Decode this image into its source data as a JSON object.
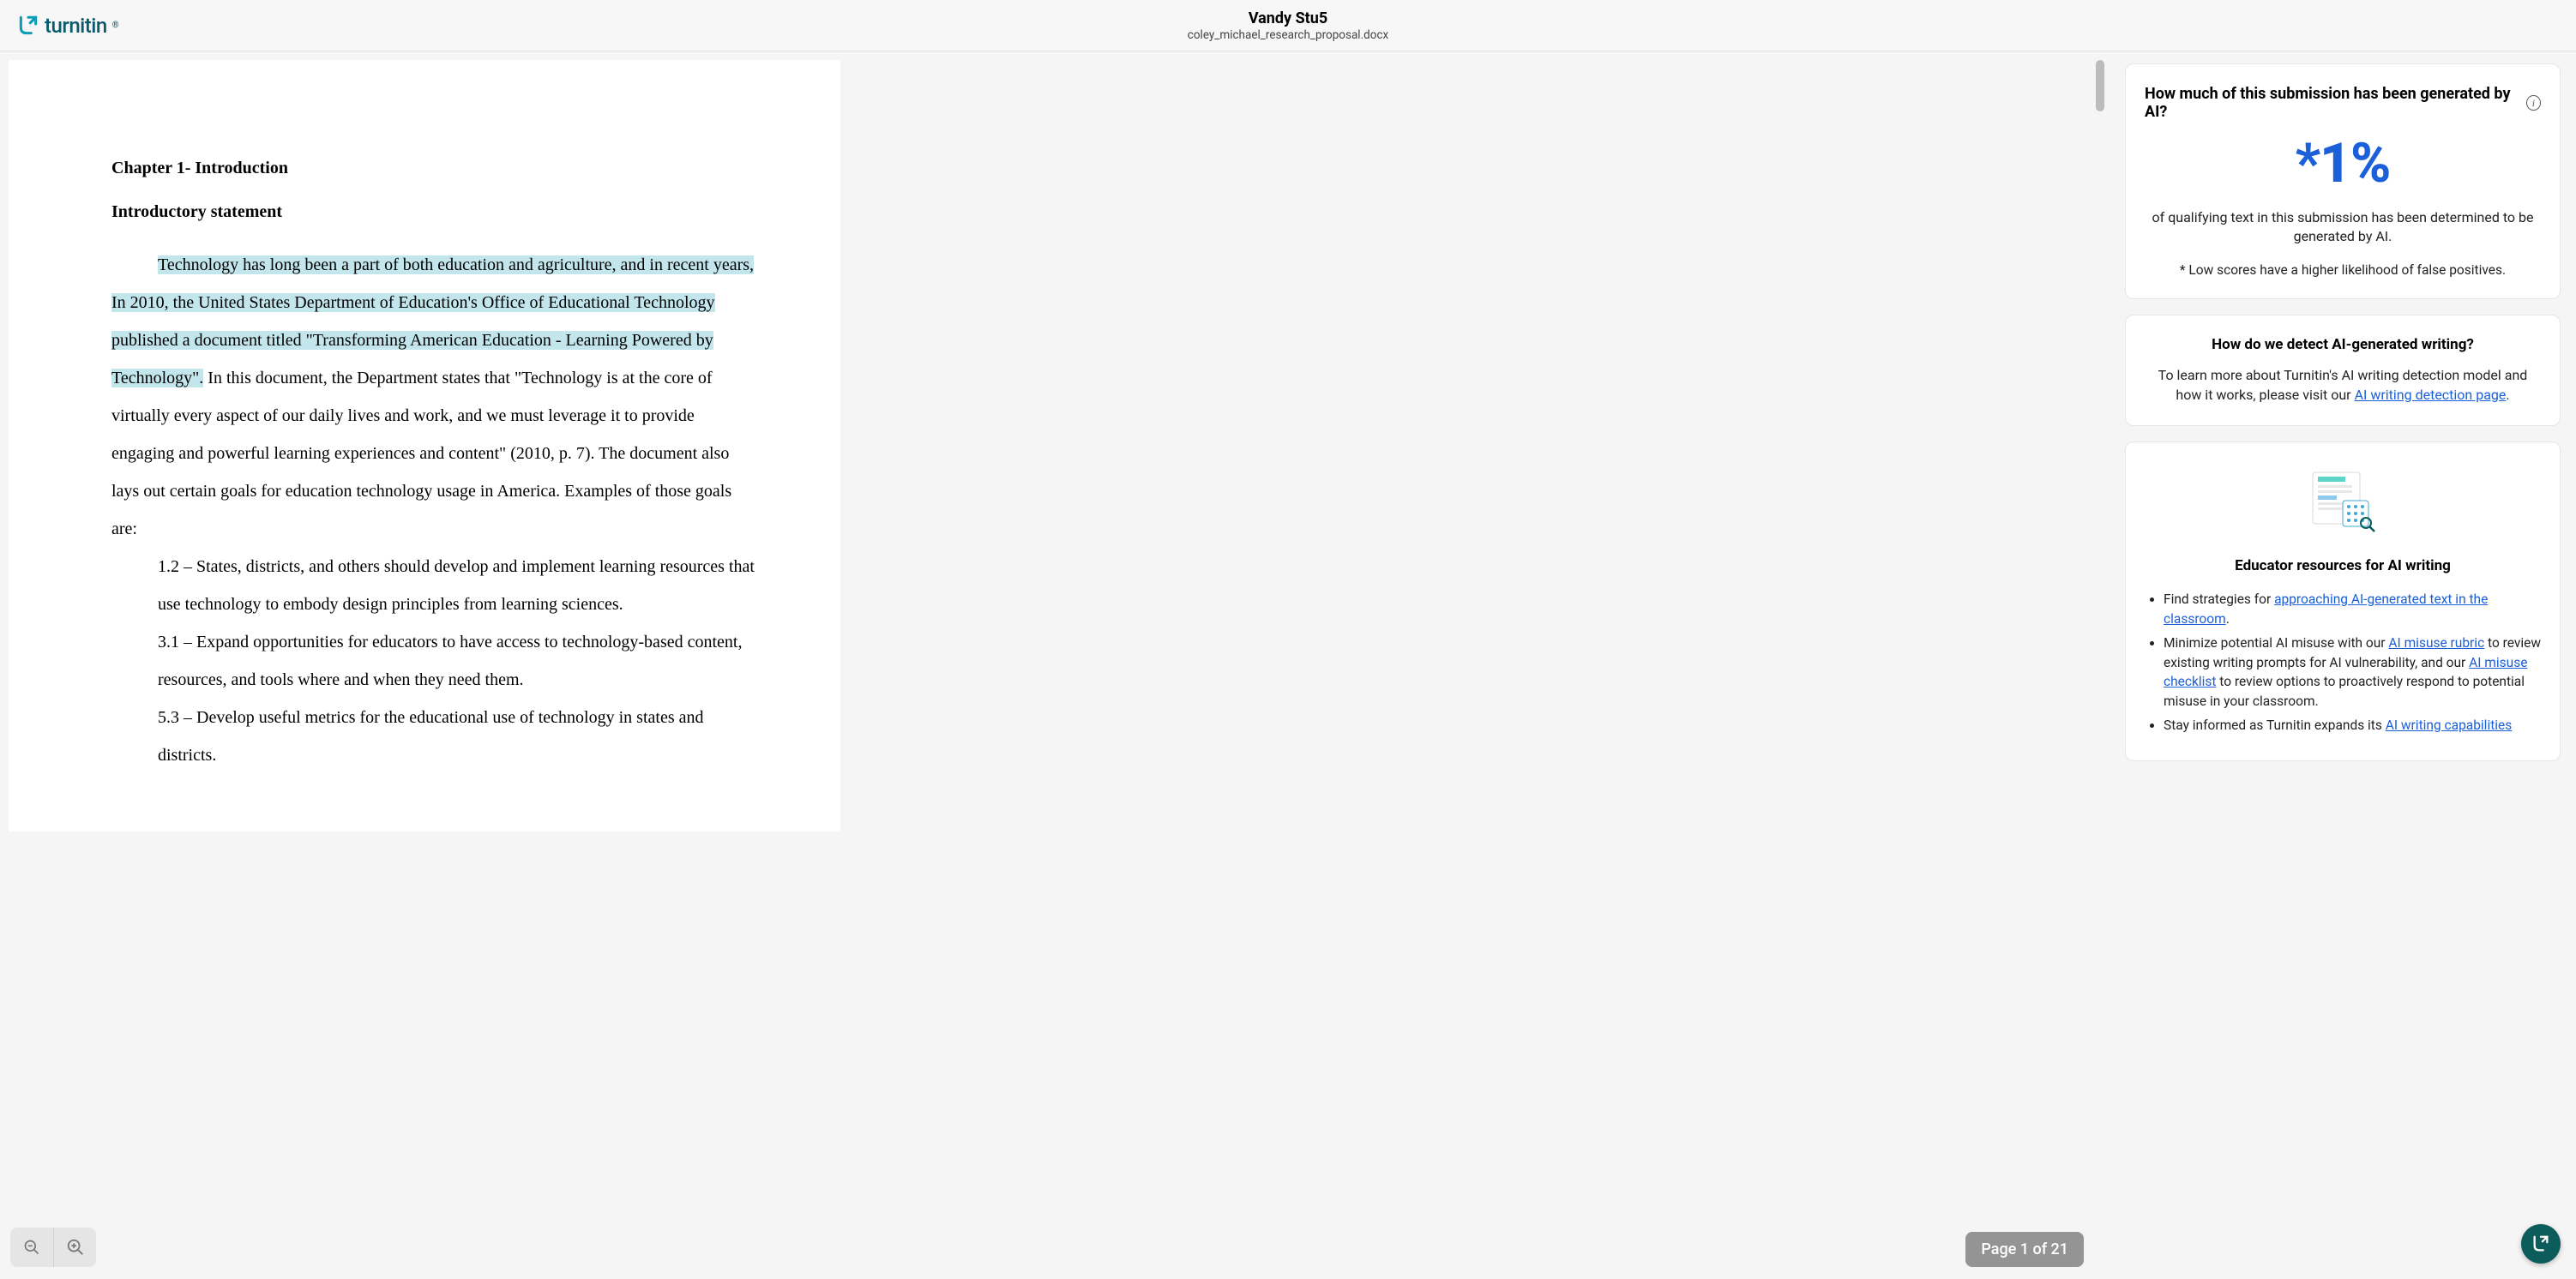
{
  "header": {
    "brand": "turnitin",
    "student": "Vandy Stu5",
    "file": "coley_michael_research_proposal.docx"
  },
  "document": {
    "chapter_title": "Chapter 1- Introduction",
    "section_title": "Introductory statement",
    "para1_hl": "Technology has long been a part of both education and agriculture, and in recent years, In 2010, the United States Department of Education's Office of Educational Technology published a document titled \"Transforming American Education - Learning Powered by Technology\".",
    "para1_rest": " In this document, the Department states that \"Technology is at the core of virtually every aspect of our daily lives and work, and we must leverage it to provide engaging and powerful learning experiences and content\" (2010, p. 7). The document also lays out certain goals for education technology usage in America. Examples of those goals are:",
    "goals": [
      "1.2 – States, districts, and others should develop and implement learning resources that use technology to embody design principles from learning sciences.",
      "3.1 – Expand opportunities for educators to have access to technology-based content, resources, and tools where and when they need them.",
      "5.3 – Develop useful metrics for the educational use of technology in states and districts."
    ]
  },
  "pager": {
    "label": "Page 1 of 21"
  },
  "ai_card": {
    "question": "How much of this submission has been generated by AI?",
    "score": "*1%",
    "desc": "of qualifying text in this submission has been determined to be generated by AI.",
    "note": "* Low scores have a higher likelihood of false positives."
  },
  "detect_card": {
    "title": "How do we detect AI-generated writing?",
    "body_pre": "To learn more about Turnitin's AI writing detection model and how it works, please visit our ",
    "body_link": "AI writing detection page",
    "body_post": "."
  },
  "resources_card": {
    "title": "Educator resources for AI writing",
    "item1_pre": "Find strategies for ",
    "item1_link": "approaching AI-generated text in the classroom",
    "item1_post": ".",
    "item2_pre": "Minimize potential AI misuse with our ",
    "item2_link1": "AI misuse rubric",
    "item2_mid": " to review existing writing prompts for AI vulnerability, and our ",
    "item2_link2": "AI misuse checklist",
    "item2_post": " to review options to proactively respond to potential misuse in your classroom.",
    "item3_pre": "Stay informed as Turnitin expands its ",
    "item3_link": "AI writing capabilities"
  }
}
